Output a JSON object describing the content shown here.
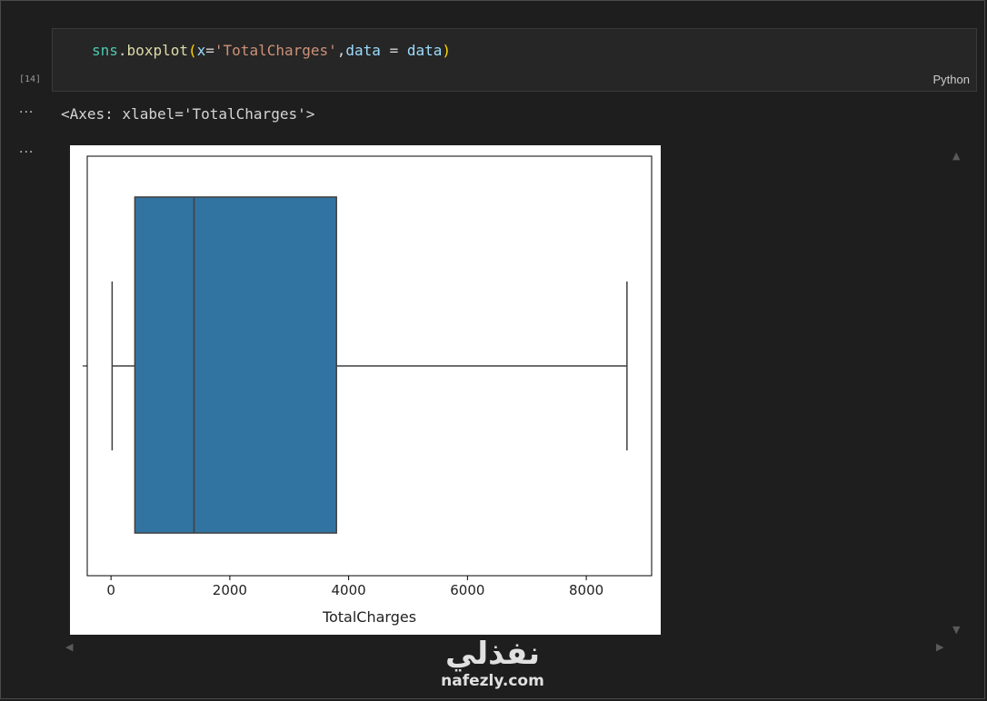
{
  "cell": {
    "execution_count": "[14]",
    "language": "Python",
    "code": {
      "module": "sns",
      "dot": ".",
      "function": "boxplot",
      "open_paren": "(",
      "param_x": "x",
      "eq1": "=",
      "string_arg": "'TotalCharges'",
      "comma": ",",
      "param_data": "data",
      "eq2": " = ",
      "value_data": "data",
      "close_paren": ")"
    }
  },
  "output": {
    "ellipsis_1": "···",
    "ellipsis_2": "···",
    "text": "<Axes: xlabel='TotalCharges'>"
  },
  "chart_data": {
    "type": "boxplot",
    "xlabel": "TotalCharges",
    "ylabel": "",
    "xlim": [
      -400,
      9100
    ],
    "x_ticks": [
      0,
      2000,
      4000,
      6000,
      8000
    ],
    "x_tick_labels": [
      "0",
      "2000",
      "4000",
      "6000",
      "8000"
    ],
    "box": {
      "whisker_low": 18.8,
      "q1": 401.4,
      "median": 1397.5,
      "q3": 3794.7,
      "whisker_high": 8684.8
    },
    "box_color": "#3274a1",
    "grid": false
  },
  "watermark": {
    "arabic": "نفذلي",
    "latin": "nafezly.com"
  },
  "colors": {
    "background": "#1e1e1e",
    "cell_background": "#262626",
    "box_fill": "#3274a1"
  }
}
